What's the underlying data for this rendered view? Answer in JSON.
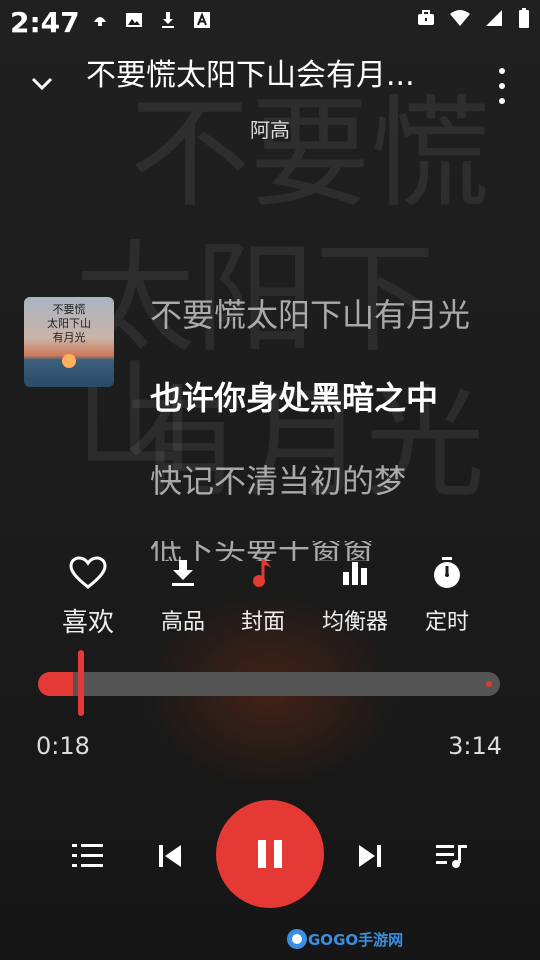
{
  "status": {
    "time": "2:47",
    "left_icons": [
      "notification-icon",
      "image-icon",
      "download-icon",
      "font-icon"
    ],
    "right_icons": [
      "briefcase-icon",
      "wifi-icon",
      "signal-icon",
      "battery-icon"
    ]
  },
  "header": {
    "title": "不要慌太阳下山会有月...",
    "artist": "阿高"
  },
  "background_text": [
    "不要慌",
    "太阳下山",
    "有月光"
  ],
  "cover": {
    "text_line1": "不要慌",
    "text_line2": "太阳下山",
    "text_line3": "有月光"
  },
  "lyrics": [
    {
      "text": "不要慌太阳下山有月光",
      "current": false
    },
    {
      "text": "也许你身处黑暗之中",
      "current": true
    },
    {
      "text": "快记不清当初的梦",
      "current": false
    },
    {
      "text": "低下头要千窗窗",
      "current": false
    }
  ],
  "actions": [
    {
      "label": "喜欢",
      "icon": "heart-icon"
    },
    {
      "label": "高品",
      "icon": "download-icon"
    },
    {
      "label": "封面",
      "icon": "music-note-icon"
    },
    {
      "label": "均衡器",
      "icon": "equalizer-icon"
    },
    {
      "label": "定时",
      "icon": "timer-icon"
    }
  ],
  "playback": {
    "elapsed": "0:18",
    "duration": "3:14",
    "progress_fraction": 0.093,
    "is_playing": true
  },
  "colors": {
    "accent": "#e53935",
    "background": "#1b1b1b"
  },
  "transport_icons": [
    "playlist-numbered-icon",
    "skip-previous-icon",
    "pause-icon",
    "skip-next-icon",
    "queue-music-icon"
  ],
  "watermark": "GOGO手游网"
}
